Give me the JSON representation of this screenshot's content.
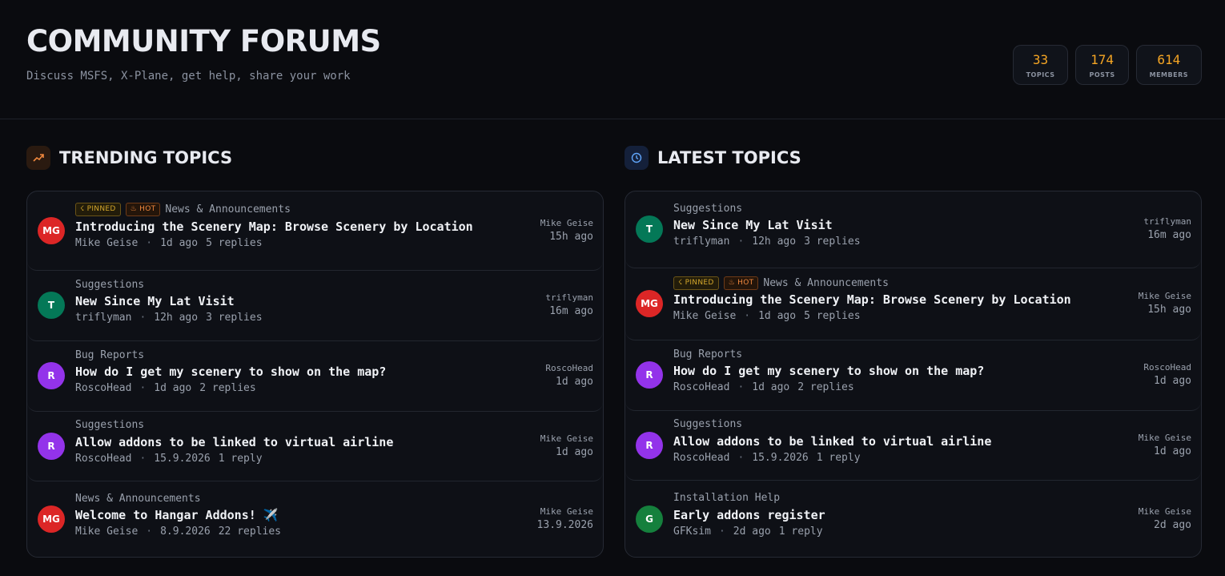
{
  "header": {
    "title": "COMMUNITY FORUMS",
    "subtitle": "Discuss MSFS, X-Plane, get help, share your work"
  },
  "stats": [
    {
      "value": "33",
      "label": "TOPICS"
    },
    {
      "value": "174",
      "label": "POSTS"
    },
    {
      "value": "614",
      "label": "MEMBERS"
    }
  ],
  "trending": {
    "title": "TRENDING TOPICS",
    "icon": "trending-up-icon",
    "topics": [
      {
        "initials": "MG",
        "avatar_color": "#dc2626",
        "pinned": true,
        "hot": true,
        "category": "News & Announcements",
        "title": "Introducing the Scenery Map: Browse Scenery by Location",
        "author": "Mike Geise",
        "age": "1d ago",
        "replies": "5 replies",
        "last_user": "Mike Geise",
        "last_time": "15h ago"
      },
      {
        "initials": "T",
        "avatar_color": "#047857",
        "pinned": false,
        "hot": false,
        "category": "Suggestions",
        "title": "New Since My Lat Visit",
        "author": "triflyman",
        "age": "12h ago",
        "replies": "3 replies",
        "last_user": "triflyman",
        "last_time": "16m ago"
      },
      {
        "initials": "R",
        "avatar_color": "#9333ea",
        "pinned": false,
        "hot": false,
        "category": "Bug Reports",
        "title": "How do I get my scenery to show on the map?",
        "author": "RoscoHead",
        "age": "1d ago",
        "replies": "2 replies",
        "last_user": "RoscoHead",
        "last_time": "1d ago"
      },
      {
        "initials": "R",
        "avatar_color": "#9333ea",
        "pinned": false,
        "hot": false,
        "category": "Suggestions",
        "title": "Allow addons to be linked to virtual airline",
        "author": "RoscoHead",
        "age": "15.9.2026",
        "replies": "1 reply",
        "last_user": "Mike Geise",
        "last_time": "1d ago"
      },
      {
        "initials": "MG",
        "avatar_color": "#dc2626",
        "pinned": false,
        "hot": false,
        "category": "News & Announcements",
        "title": "Welcome to Hangar Addons! ✈️",
        "author": "Mike Geise",
        "age": "8.9.2026",
        "replies": "22 replies",
        "last_user": "Mike Geise",
        "last_time": "13.9.2026"
      }
    ]
  },
  "latest": {
    "title": "LATEST TOPICS",
    "icon": "clock-icon",
    "topics": [
      {
        "initials": "T",
        "avatar_color": "#047857",
        "pinned": false,
        "hot": false,
        "category": "Suggestions",
        "title": "New Since My Lat Visit",
        "author": "triflyman",
        "age": "12h ago",
        "replies": "3 replies",
        "last_user": "triflyman",
        "last_time": "16m ago"
      },
      {
        "initials": "MG",
        "avatar_color": "#dc2626",
        "pinned": true,
        "hot": true,
        "category": "News & Announcements",
        "title": "Introducing the Scenery Map: Browse Scenery by Location",
        "author": "Mike Geise",
        "age": "1d ago",
        "replies": "5 replies",
        "last_user": "Mike Geise",
        "last_time": "15h ago"
      },
      {
        "initials": "R",
        "avatar_color": "#9333ea",
        "pinned": false,
        "hot": false,
        "category": "Bug Reports",
        "title": "How do I get my scenery to show on the map?",
        "author": "RoscoHead",
        "age": "1d ago",
        "replies": "2 replies",
        "last_user": "RoscoHead",
        "last_time": "1d ago"
      },
      {
        "initials": "R",
        "avatar_color": "#9333ea",
        "pinned": false,
        "hot": false,
        "category": "Suggestions",
        "title": "Allow addons to be linked to virtual airline",
        "author": "RoscoHead",
        "age": "15.9.2026",
        "replies": "1 reply",
        "last_user": "Mike Geise",
        "last_time": "1d ago"
      },
      {
        "initials": "G",
        "avatar_color": "#15803d",
        "pinned": false,
        "hot": false,
        "category": "Installation Help",
        "title": "Early addons register",
        "author": "GFKsim",
        "age": "2d ago",
        "replies": "1 reply",
        "last_user": "Mike Geise",
        "last_time": "2d ago"
      }
    ]
  },
  "badges": {
    "pinned": "PINNED",
    "hot": "HOT"
  },
  "colors": {
    "accent": "#f5a524",
    "trending_icon": "#f0883e",
    "latest_icon": "#60a5fa"
  }
}
